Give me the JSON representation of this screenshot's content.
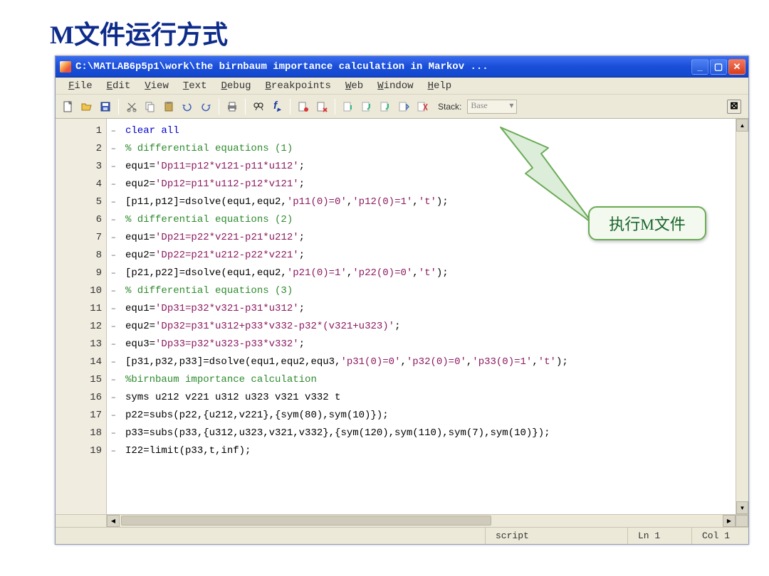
{
  "page_title": "M文件运行方式",
  "window_title": "C:\\MATLAB6p5p1\\work\\the birnbaum importance calculation in Markov ...",
  "menubar": [
    "File",
    "Edit",
    "View",
    "Text",
    "Debug",
    "Breakpoints",
    "Web",
    "Window",
    "Help"
  ],
  "toolbar": {
    "stack_label": "Stack:",
    "stack_value": "Base"
  },
  "callout": "执行M文件",
  "status": {
    "type": "script",
    "ln": "Ln 1",
    "col": "Col 1"
  },
  "code_lines": [
    {
      "n": 1,
      "type": "kw",
      "text": "clear all"
    },
    {
      "n": 2,
      "type": "com",
      "text": "% differential equations (1)"
    },
    {
      "n": 3,
      "type": "plain",
      "parts": [
        [
          "plain",
          "equ1="
        ],
        [
          "str",
          "'Dp11=p12*v121-p11*u112'"
        ],
        [
          "plain",
          ";"
        ]
      ]
    },
    {
      "n": 4,
      "type": "plain",
      "parts": [
        [
          "plain",
          "equ2="
        ],
        [
          "str",
          "'Dp12=p11*u112-p12*v121'"
        ],
        [
          "plain",
          ";"
        ]
      ]
    },
    {
      "n": 5,
      "type": "plain",
      "parts": [
        [
          "plain",
          "[p11,p12]=dsolve(equ1,equ2,"
        ],
        [
          "str",
          "'p11(0)=0'"
        ],
        [
          "plain",
          ","
        ],
        [
          "str",
          "'p12(0)=1'"
        ],
        [
          "plain",
          ","
        ],
        [
          "str",
          "'t'"
        ],
        [
          "plain",
          ");"
        ]
      ]
    },
    {
      "n": 6,
      "type": "com",
      "text": "% differential equations (2)"
    },
    {
      "n": 7,
      "type": "plain",
      "parts": [
        [
          "plain",
          "equ1="
        ],
        [
          "str",
          "'Dp21=p22*v221-p21*u212'"
        ],
        [
          "plain",
          ";"
        ]
      ]
    },
    {
      "n": 8,
      "type": "plain",
      "parts": [
        [
          "plain",
          "equ2="
        ],
        [
          "str",
          "'Dp22=p21*u212-p22*v221'"
        ],
        [
          "plain",
          ";"
        ]
      ]
    },
    {
      "n": 9,
      "type": "plain",
      "parts": [
        [
          "plain",
          "[p21,p22]=dsolve(equ1,equ2,"
        ],
        [
          "str",
          "'p21(0)=1'"
        ],
        [
          "plain",
          ","
        ],
        [
          "str",
          "'p22(0)=0'"
        ],
        [
          "plain",
          ","
        ],
        [
          "str",
          "'t'"
        ],
        [
          "plain",
          ");"
        ]
      ]
    },
    {
      "n": 10,
      "type": "com",
      "text": "% differential equations (3)"
    },
    {
      "n": 11,
      "type": "plain",
      "parts": [
        [
          "plain",
          "equ1="
        ],
        [
          "str",
          "'Dp31=p32*v321-p31*u312'"
        ],
        [
          "plain",
          ";"
        ]
      ]
    },
    {
      "n": 12,
      "type": "plain",
      "parts": [
        [
          "plain",
          "equ2="
        ],
        [
          "str",
          "'Dp32=p31*u312+p33*v332-p32*(v321+u323)'"
        ],
        [
          "plain",
          ";"
        ]
      ]
    },
    {
      "n": 13,
      "type": "plain",
      "parts": [
        [
          "plain",
          "equ3="
        ],
        [
          "str",
          "'Dp33=p32*u323-p33*v332'"
        ],
        [
          "plain",
          ";"
        ]
      ]
    },
    {
      "n": 14,
      "type": "plain",
      "parts": [
        [
          "plain",
          "[p31,p32,p33]=dsolve(equ1,equ2,equ3,"
        ],
        [
          "str",
          "'p31(0)=0'"
        ],
        [
          "plain",
          ","
        ],
        [
          "str",
          "'p32(0)=0'"
        ],
        [
          "plain",
          ","
        ],
        [
          "str",
          "'p33(0)=1'"
        ],
        [
          "plain",
          ","
        ],
        [
          "str",
          "'t'"
        ],
        [
          "plain",
          ");"
        ]
      ]
    },
    {
      "n": 15,
      "type": "com",
      "text": "%birnbaum importance calculation"
    },
    {
      "n": 16,
      "type": "plain",
      "parts": [
        [
          "plain",
          "syms u212 v221 u312 u323 v321 v332 t"
        ]
      ]
    },
    {
      "n": 17,
      "type": "plain",
      "parts": [
        [
          "plain",
          "p22=subs(p22,{u212,v221},{sym(80),sym(10)});"
        ]
      ]
    },
    {
      "n": 18,
      "type": "plain",
      "parts": [
        [
          "plain",
          "p33=subs(p33,{u312,u323,v321,v332},{sym(120),sym(110),sym(7),sym(10)});"
        ]
      ]
    },
    {
      "n": 19,
      "type": "plain",
      "parts": [
        [
          "plain",
          "I22=limit(p33,t,inf);"
        ]
      ]
    }
  ]
}
